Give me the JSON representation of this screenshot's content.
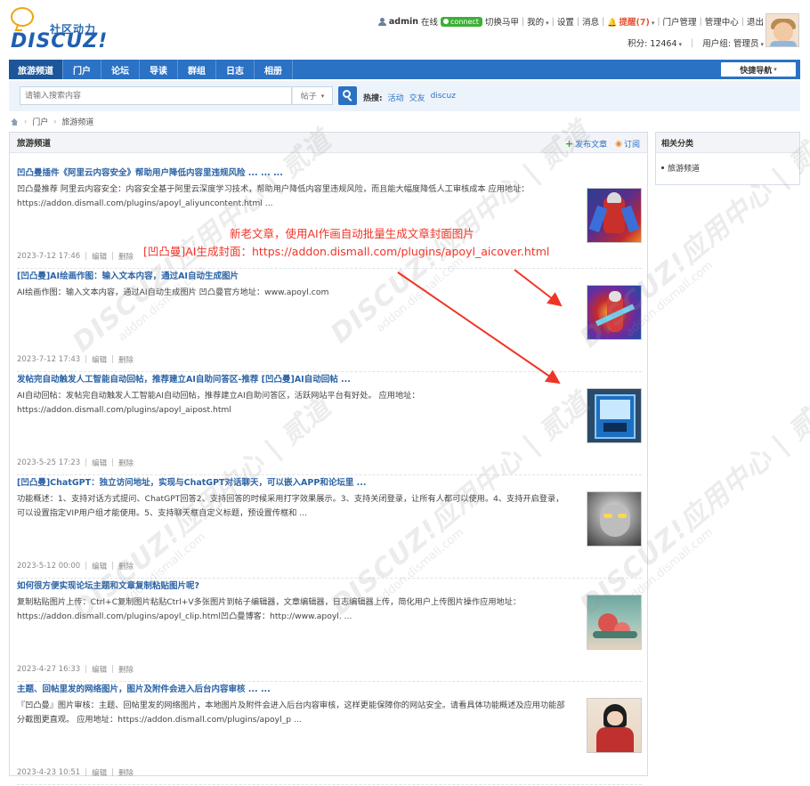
{
  "logo": {
    "cn": "社区动力",
    "en": "DISCUZ!"
  },
  "user_nav": {
    "username": "admin",
    "status": "在线",
    "connect": "connect",
    "switch_vest": "切换马甲",
    "my": "我的",
    "settings": "设置",
    "messages": "消息",
    "notice": "提醒(7)",
    "portal_manage": "门户管理",
    "admin_center": "管理中心",
    "logout": "退出",
    "credits": "积分: 12464",
    "usergroup": "用户组: 管理员"
  },
  "nav": {
    "items": [
      {
        "label": "旅游频道",
        "active": true
      },
      {
        "label": "门户"
      },
      {
        "label": "论坛"
      },
      {
        "label": "导读"
      },
      {
        "label": "群组"
      },
      {
        "label": "日志"
      },
      {
        "label": "相册"
      }
    ],
    "quick_nav": "快捷导航"
  },
  "search": {
    "placeholder": "请输入搜索内容",
    "type": "帖子",
    "hot_label": "热搜:",
    "hot_words": [
      "活动",
      "交友",
      "discuz"
    ]
  },
  "breadcrumb": [
    "门户",
    "旅游频道"
  ],
  "panel": {
    "title": "旅游频道",
    "post_action": "发布文章",
    "subscribe_action": "订阅"
  },
  "meta_labels": {
    "edit": "编辑",
    "delete": "删除"
  },
  "articles": [
    {
      "title": "凹凸曼插件《阿里云内容安全》帮助用户降低内容里违规风险 ... ... ...",
      "summary": "凹凸曼推荐 阿里云内容安全：内容安全基于阿里云深度学习技术，帮助用户降低内容里违规风险，而且能大幅度降低人工审核成本 应用地址：https://addon.dismall.com/plugins/apoyl_aliyuncontent.html ...",
      "date": "2023-7-12 17:46"
    },
    {
      "title": "[凹凸曼]AI绘画作图：输入文本内容，通过AI自动生成图片",
      "summary": "AI绘画作图：输入文本内容，通过AI自动生成图片 凹凸曼官方地址：www.apoyl.com",
      "date": "2023-7-12 17:43"
    },
    {
      "title": "发帖完自动触发人工智能自动回帖，推荐建立AI自助问答区-推荐 [凹凸曼]AI自动回帖 ...",
      "summary": "AI自动回帖：发帖完自动触发人工智能AI自动回帖，推荐建立AI自助问答区，活跃网站平台有好处。 应用地址：https://addon.dismall.com/plugins/apoyl_aipost.html",
      "date": "2023-5-25 17:23"
    },
    {
      "title": "[凹凸曼]ChatGPT：独立访问地址，实现与ChatGPT对话聊天，可以嵌入APP和论坛里 ...",
      "summary": "功能概述：1、支持对话方式提问、ChatGPT回答2、支持回答的时候采用打字效果展示。3、支持关闭登录，让所有人都可以使用。4、支持开启登录，可以设置指定VIP用户组才能使用。5、支持聊天框自定义标题，预设置传框和 ...",
      "date": "2023-5-12 00:00"
    },
    {
      "title": "如何很方便实现论坛主题和文章复制粘贴图片呢?",
      "summary": "复制粘贴图片上传：Ctrl+C复制图片粘贴Ctrl+V多张图片到帖子编辑器，文章编辑器，日志编辑器上传，简化用户上传图片操作应用地址：https://addon.dismall.com/plugins/apoyl_clip.html凹凸曼博客：http://www.apoyl. ...",
      "date": "2023-4-27 16:33"
    },
    {
      "title": "主题、回帖里发的网络图片，图片及附件会进入后台内容审核 ... ...",
      "summary": "『凹凸曼』图片审核：主题、回帖里发的网络图片，本地图片及附件会进入后台内容审核，这样更能保障你的网站安全。请看具体功能概述及应用功能部分截图更直观。 应用地址：https://addon.dismall.com/plugins/apoyl_p ...",
      "date": "2023-4-23 10:51"
    }
  ],
  "annotation": {
    "line1": "新老文章，使用AI作画自动批量生成文章封面图片",
    "line2": "[凹凸曼]AI生成封面：https://addon.dismall.com/plugins/apoyl_aicover.html",
    "color": "#f03428"
  },
  "sidebar": {
    "title": "相关分类",
    "items": [
      "旅游频道"
    ]
  },
  "watermark": {
    "main": "DISCUZ!应用中心 | 贰道",
    "sub": "addon.dismall.com"
  }
}
